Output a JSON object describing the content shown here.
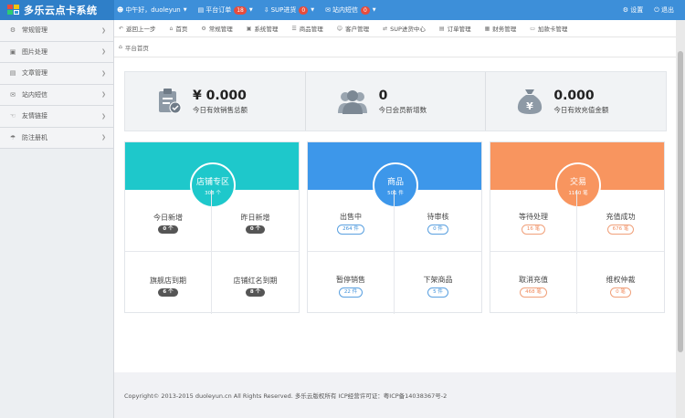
{
  "app": {
    "title": "多乐云点卡系统"
  },
  "topnav": {
    "greeting": "中午好，duoleyun",
    "platform_orders": "平台订单",
    "platform_orders_count": "18",
    "sup_purchase": "SUP进货",
    "sup_purchase_count": "0",
    "site_messages": "站内短信",
    "site_messages_count": "0",
    "settings": "设置",
    "logout": "退出"
  },
  "sidebar": {
    "items": [
      {
        "label": "常规管理",
        "icon": "gear-icon"
      },
      {
        "label": "图片处理",
        "icon": "image-icon"
      },
      {
        "label": "文章管理",
        "icon": "document-icon"
      },
      {
        "label": "站内短信",
        "icon": "message-icon"
      },
      {
        "label": "友情链接",
        "icon": "thumbs-up-icon"
      },
      {
        "label": "防注册机",
        "icon": "umbrella-icon"
      }
    ]
  },
  "shortcuts": [
    {
      "label": "返回上一步",
      "icon": "back-icon"
    },
    {
      "label": "首页",
      "icon": "home-icon"
    },
    {
      "label": "常规管理",
      "icon": "gear-icon"
    },
    {
      "label": "系统管理",
      "icon": "monitor-icon"
    },
    {
      "label": "商品管理",
      "icon": "list-icon"
    },
    {
      "label": "客户管理",
      "icon": "users-icon"
    },
    {
      "label": "SUP进货中心",
      "icon": "exchange-icon"
    },
    {
      "label": "订单管理",
      "icon": "order-icon"
    },
    {
      "label": "财务管理",
      "icon": "finance-icon"
    },
    {
      "label": "加款卡管理",
      "icon": "card-icon"
    }
  ],
  "breadcrumb": {
    "label": "平台首页"
  },
  "summary": [
    {
      "value": "¥ 0.000",
      "label": "今日有效销售总额",
      "icon": "clipboard-check-icon"
    },
    {
      "value": "0",
      "label": "今日会员新增数",
      "icon": "members-icon"
    },
    {
      "value": "0.000",
      "label": "今日有效充值金额",
      "icon": "money-bag-icon"
    }
  ],
  "cards": {
    "shop": {
      "title": "店铺专区",
      "subtitle": "308 个",
      "color": "#1ec8cb",
      "cells": [
        {
          "label": "今日新增",
          "value": "0 个"
        },
        {
          "label": "昨日新增",
          "value": "0 个"
        },
        {
          "label": "旗舰店到期",
          "value": "6 个"
        },
        {
          "label": "店铺红名到期",
          "value": "8 个"
        }
      ]
    },
    "goods": {
      "title": "商品",
      "subtitle": "501 件",
      "color": "#3d97ea",
      "cells": [
        {
          "label": "出售中",
          "value": "264 件"
        },
        {
          "label": "待审核",
          "value": "0 件"
        },
        {
          "label": "暂停销售",
          "value": "22 件"
        },
        {
          "label": "下架商品",
          "value": "5 件"
        }
      ]
    },
    "trade": {
      "title": "交易",
      "subtitle": "1160 笔",
      "color": "#f8955f",
      "cells": [
        {
          "label": "等待处理",
          "value": "16 笔"
        },
        {
          "label": "充值成功",
          "value": "676 笔"
        },
        {
          "label": "取消充值",
          "value": "468 笔"
        },
        {
          "label": "维权仲裁",
          "value": "0 笔"
        }
      ]
    }
  },
  "footer": {
    "text": "Copyright© 2013-2015 duoleyun.cn All Rights Reserved. 多乐云版权所有 ICP经营许可证：粤ICP备14038367号-2"
  }
}
